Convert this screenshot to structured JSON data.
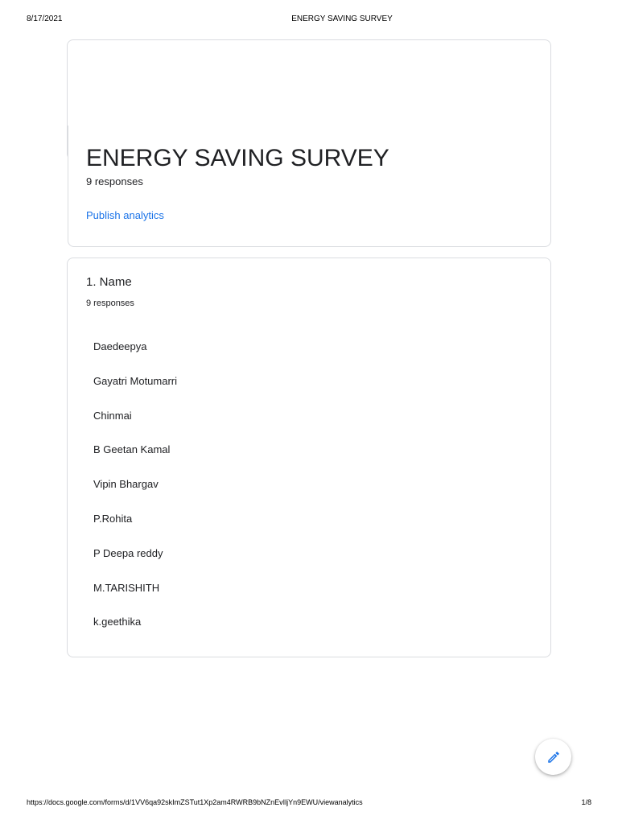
{
  "print_header": {
    "date": "8/17/2021",
    "title": "ENERGY SAVING SURVEY"
  },
  "form": {
    "title": "ENERGY SAVING SURVEY",
    "responses": "9 responses",
    "publish_label": "Publish analytics"
  },
  "question": {
    "title": "1. Name",
    "responses": "9 responses",
    "answers": [
      "Daedeepya",
      "Gayatri Motumarri",
      "Chinmai",
      "B Geetan Kamal",
      "Vipin Bhargav",
      "P.Rohita",
      "P Deepa reddy",
      "M.TARISHITH",
      "k.geethika"
    ]
  },
  "fab": {
    "icon": "pencil-icon"
  },
  "print_footer": {
    "url": "https://docs.google.com/forms/d/1VV6qa92skImZSTut1Xp2am4RWRB9bNZnEvIljYn9EWU/viewanalytics",
    "page": "1/8"
  },
  "colors": {
    "link": "#1a73e8",
    "border": "#dadce0",
    "text": "#202124",
    "fab_icon": "#1a73e8"
  }
}
